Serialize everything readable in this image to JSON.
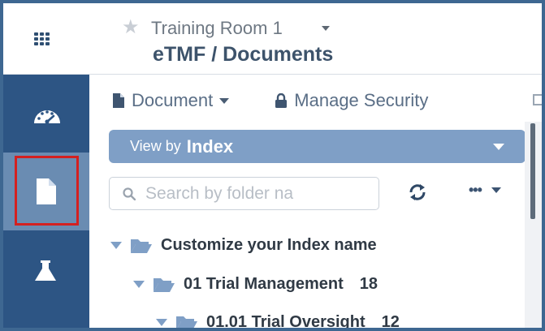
{
  "header": {
    "workspace": "Training Room 1",
    "title": "eTMF / Documents"
  },
  "sidebar": {
    "items": [
      {
        "name": "dashboard",
        "icon": "dashboard-icon"
      },
      {
        "name": "documents",
        "icon": "document-icon",
        "active": true,
        "highlighted": true
      },
      {
        "name": "lab",
        "icon": "flask-icon"
      }
    ]
  },
  "toolbar": {
    "document_label": "Document",
    "security_label": "Manage Security"
  },
  "view_by": {
    "prefix": "View by",
    "value": "Index"
  },
  "search": {
    "placeholder": "Search by folder na"
  },
  "tree": {
    "root": {
      "label": "Customize your Index name"
    },
    "level1": {
      "label": "01 Trial Management",
      "count": "18"
    },
    "level2": {
      "label": "01.01 Trial Oversight",
      "count": "12"
    }
  },
  "colors": {
    "sidebar": "#2d5584",
    "sidebar_active": "#6a8cb2",
    "view_by_bar": "#7f9fc6",
    "highlight_box": "#d42020",
    "frame": "#3e6791"
  }
}
